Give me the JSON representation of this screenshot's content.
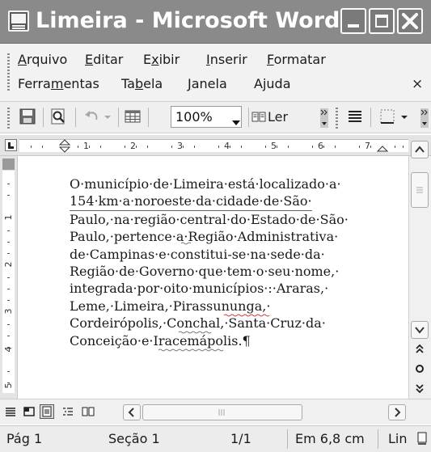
{
  "window": {
    "title": "Limeira - Microsoft Word"
  },
  "menu": {
    "items": [
      {
        "label": "Arquivo",
        "mnemonic": "A"
      },
      {
        "label": "Editar",
        "mnemonic": "E"
      },
      {
        "label": "Exibir",
        "mnemonic": "x"
      },
      {
        "label": "Inserir",
        "mnemonic": "I"
      },
      {
        "label": "Formatar",
        "mnemonic": "F"
      },
      {
        "label": "Ferramentas",
        "mnemonic": "m"
      },
      {
        "label": "Tabela",
        "mnemonic": "b"
      },
      {
        "label": "Janela",
        "mnemonic": "J"
      },
      {
        "label": "Ajuda",
        "mnemonic": "j"
      }
    ],
    "close_glyph": "×"
  },
  "toolbar": {
    "zoom": "100%",
    "read_label": "Ler",
    "icons": [
      "save-icon",
      "print-preview-icon",
      "undo-icon",
      "table-icon",
      "read-mode-icon",
      "align-justify-icon",
      "borders-icon"
    ]
  },
  "ruler": {
    "numbers": [
      "1",
      "2",
      "3",
      "4",
      "5",
      "6",
      "7"
    ]
  },
  "vertical_ruler": {
    "numbers": [
      "1",
      "2",
      "3",
      "4",
      "5"
    ]
  },
  "document": {
    "lines": [
      "O·município·de·Limeira·está·localizado·a·",
      "154·km·a·noroeste·da·cidade·de·São·",
      "Paulo,·na·região·central·do·Estado·de·São·",
      "Paulo,·pertence·a·Região·Administrativa·",
      "de·Campinas·e·constitui-se·na·sede·da·",
      "Região·de·Governo·que·tem·o·seu·nome,·",
      "integrada·por·oito·municípios·:·Araras,·",
      "Leme,·Limeira,·Pirassununga,·",
      "Cordeirópolis,·Conchal,·Santa·Cruz·da·",
      "Conceição·e·Iracemápolis.¶"
    ]
  },
  "status": {
    "page": "Pág 1",
    "section": "Seção 1",
    "pages": "1/1",
    "position": "Em 6,8 cm",
    "line": "Lin"
  },
  "colors": {
    "titlebar": "#8a8a8a",
    "chrome": "#f0f0f0",
    "spell_error": "#cc0000"
  }
}
